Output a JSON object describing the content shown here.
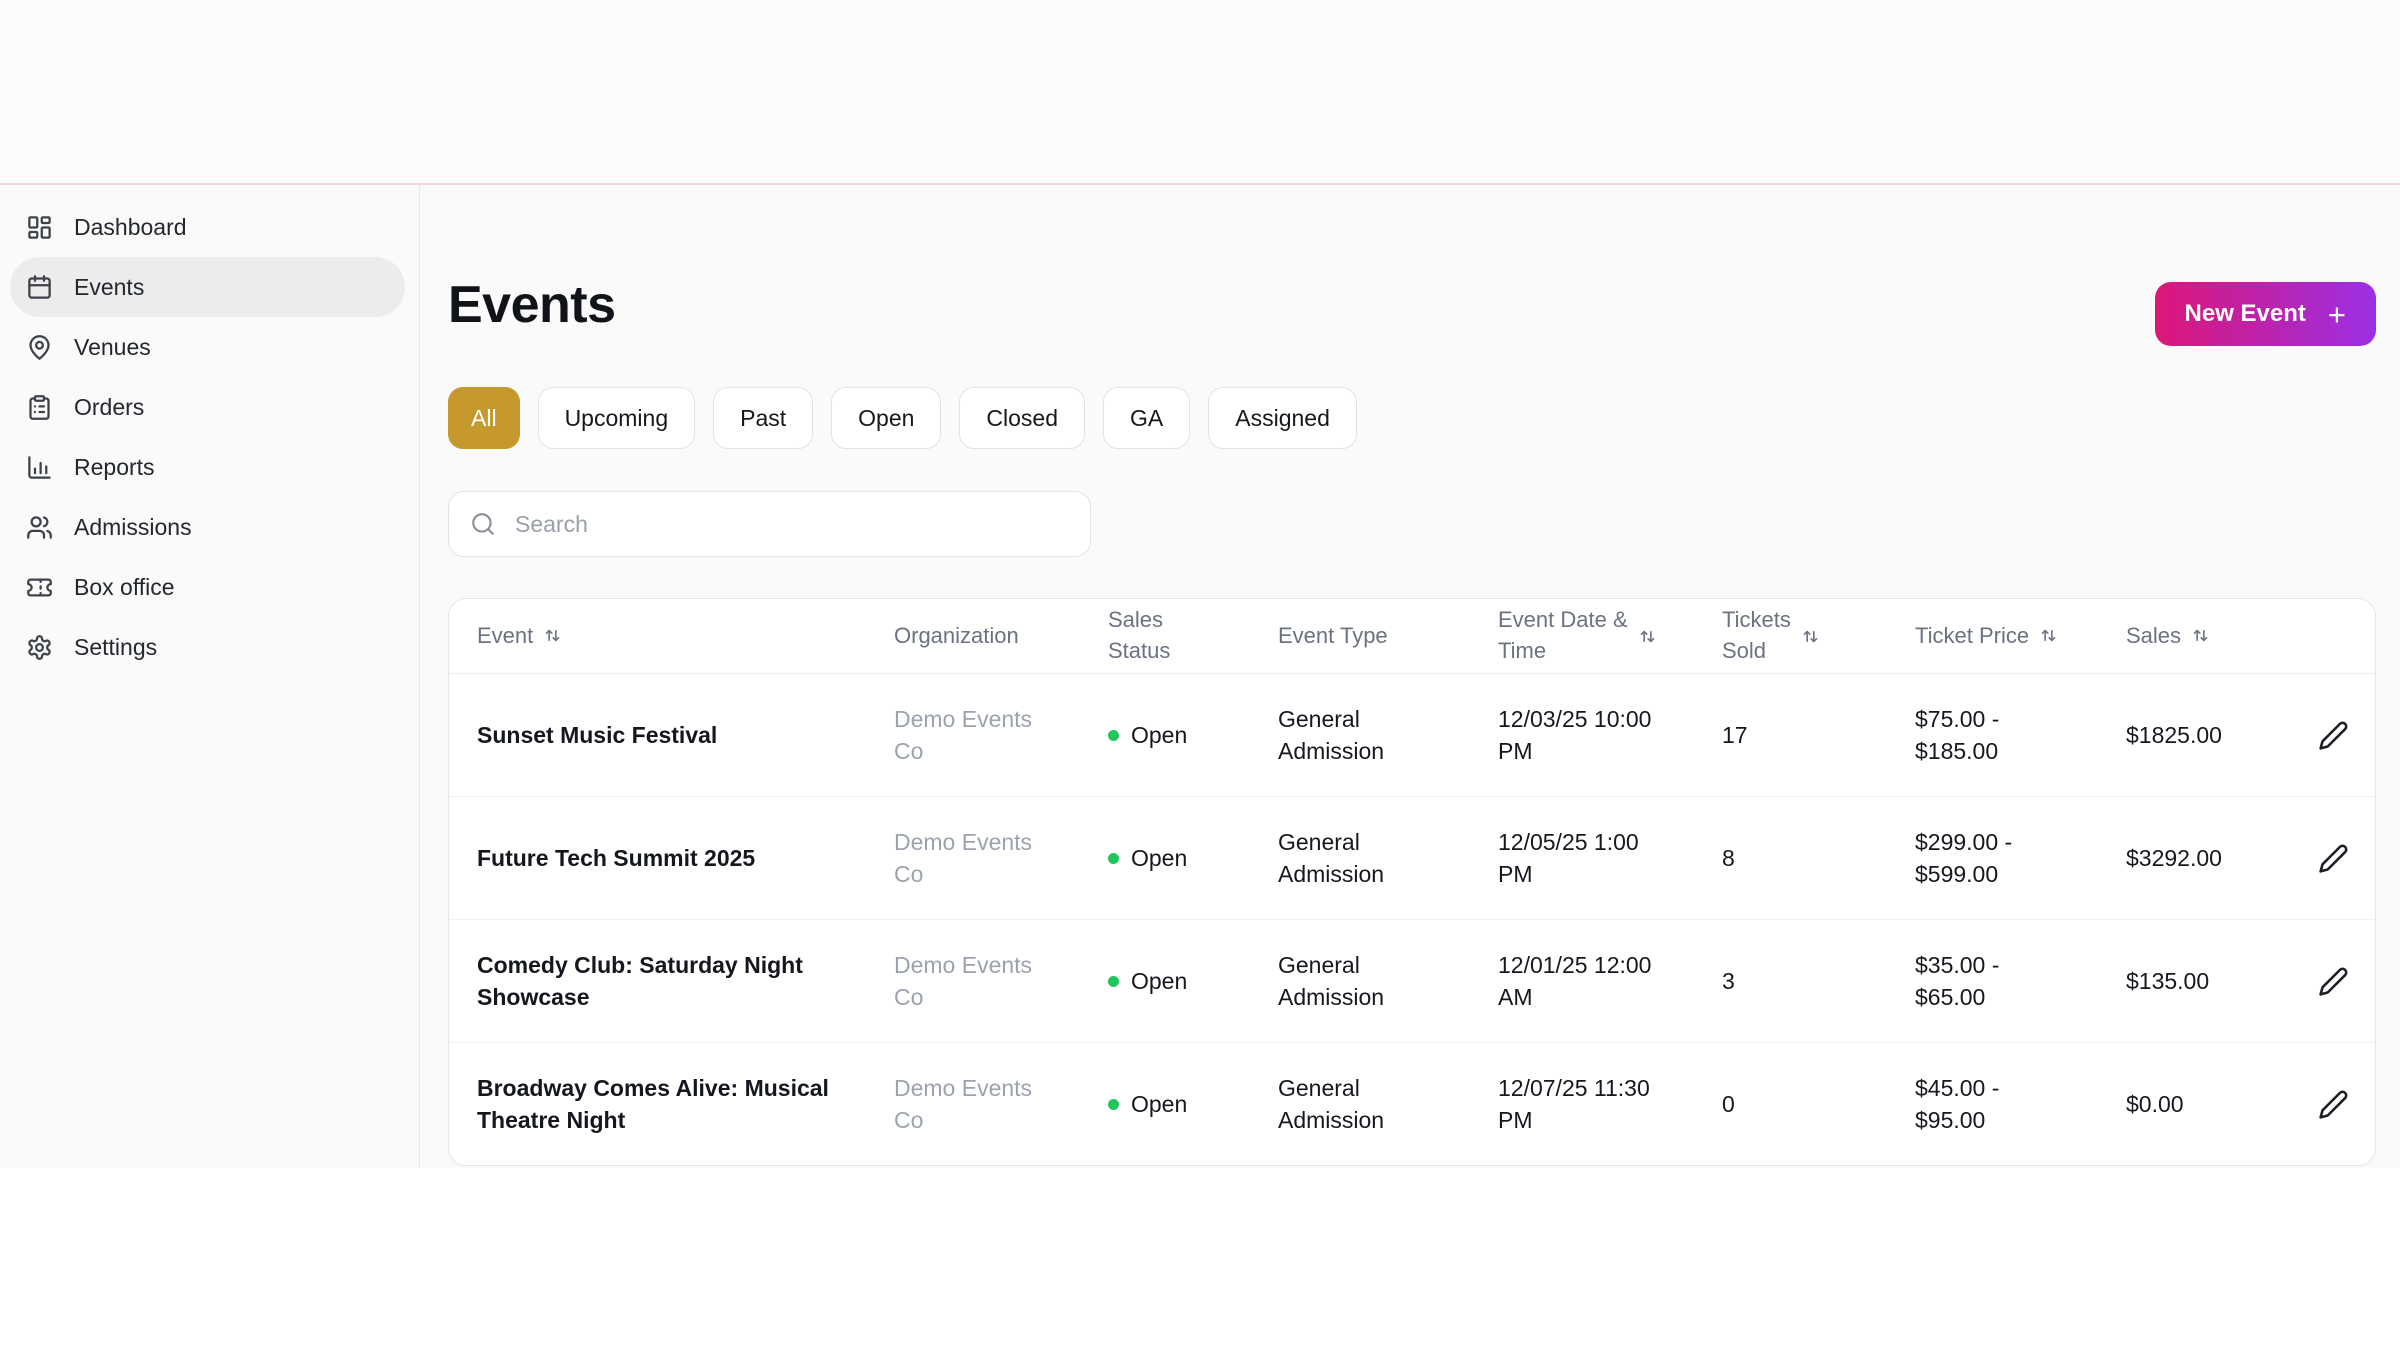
{
  "theme": {
    "gold": "#c5992e",
    "gradient_start": "#dd1677",
    "gradient_end": "#9a30e6",
    "green": "#22c55e",
    "pink_line": "#f3d6d6"
  },
  "sidebar": {
    "items": [
      {
        "label": "Dashboard",
        "icon": "layout-dashboard",
        "active": false
      },
      {
        "label": "Events",
        "icon": "calendar",
        "active": true
      },
      {
        "label": "Venues",
        "icon": "map-pin",
        "active": false
      },
      {
        "label": "Orders",
        "icon": "clipboard",
        "active": false
      },
      {
        "label": "Reports",
        "icon": "bar-chart",
        "active": false
      },
      {
        "label": "Admissions",
        "icon": "users",
        "active": false
      },
      {
        "label": "Box office",
        "icon": "ticket",
        "active": false
      },
      {
        "label": "Settings",
        "icon": "gear",
        "active": false
      }
    ]
  },
  "page": {
    "title": "Events"
  },
  "actions": {
    "new_event": {
      "label": "New Event",
      "icon_glyph": "+"
    }
  },
  "filters": [
    {
      "label": "All",
      "active": true
    },
    {
      "label": "Upcoming",
      "active": false
    },
    {
      "label": "Past",
      "active": false
    },
    {
      "label": "Open",
      "active": false
    },
    {
      "label": "Closed",
      "active": false
    },
    {
      "label": "GA",
      "active": false
    },
    {
      "label": "Assigned",
      "active": false
    }
  ],
  "search": {
    "placeholder": "Search"
  },
  "table": {
    "columns": [
      {
        "label": "Event",
        "sortable": true
      },
      {
        "label": "Organization",
        "sortable": false
      },
      {
        "label": "Sales\nStatus",
        "sortable": false
      },
      {
        "label": "Event Type",
        "sortable": false
      },
      {
        "label": "Event Date &\nTime",
        "sortable": true
      },
      {
        "label": "Tickets\nSold",
        "sortable": true
      },
      {
        "label": "Ticket Price",
        "sortable": true
      },
      {
        "label": "Sales",
        "sortable": true
      },
      {
        "label": "",
        "sortable": false
      }
    ],
    "rows": [
      {
        "event": "Sunset Music Festival",
        "organization": "Demo Events Co",
        "status": "Open",
        "event_type": "General Admission",
        "datetime": "12/03/25 10:00 PM",
        "tickets_sold": "17",
        "ticket_price": "$75.00 - $185.00",
        "sales": "$1825.00"
      },
      {
        "event": "Future Tech Summit 2025",
        "organization": "Demo Events Co",
        "status": "Open",
        "event_type": "General Admission",
        "datetime": "12/05/25 1:00 PM",
        "tickets_sold": "8",
        "ticket_price": "$299.00 - $599.00",
        "sales": "$3292.00"
      },
      {
        "event": "Comedy Club: Saturday Night Showcase",
        "organization": "Demo Events Co",
        "status": "Open",
        "event_type": "General Admission",
        "datetime": "12/01/25 12:00 AM",
        "tickets_sold": "3",
        "ticket_price": "$35.00 - $65.00",
        "sales": "$135.00"
      },
      {
        "event": "Broadway Comes Alive: Musical Theatre Night",
        "organization": "Demo Events Co",
        "status": "Open",
        "event_type": "General Admission",
        "datetime": "12/07/25 11:30 PM",
        "tickets_sold": "0",
        "ticket_price": "$45.00 - $95.00",
        "sales": "$0.00"
      }
    ]
  }
}
